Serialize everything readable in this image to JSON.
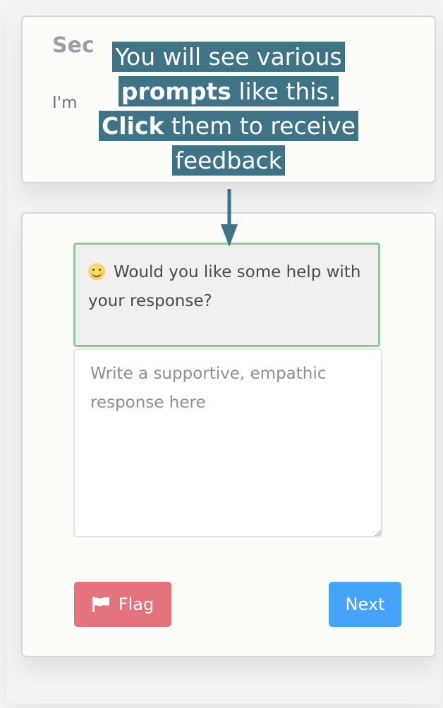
{
  "seeker": {
    "heading": "Sec",
    "text": "I'm"
  },
  "overlay": {
    "line1": "You will see various",
    "line2_bold": "prompts",
    "line2_rest": " like this.",
    "line3_bold": "Click",
    "line3_rest": " them to receive",
    "line4": "feedback"
  },
  "prompt": {
    "icon": "smiling-face-icon",
    "text": "Would you like some help with your response?"
  },
  "response": {
    "placeholder": "Write a supportive, empathic response here",
    "value": ""
  },
  "buttons": {
    "flag_label": "Flag",
    "next_label": "Next"
  },
  "colors": {
    "overlay_bg": "#3f7386",
    "prompt_border": "#92c59a",
    "flag_bg": "#e5737d",
    "next_bg": "#45a4fa"
  }
}
